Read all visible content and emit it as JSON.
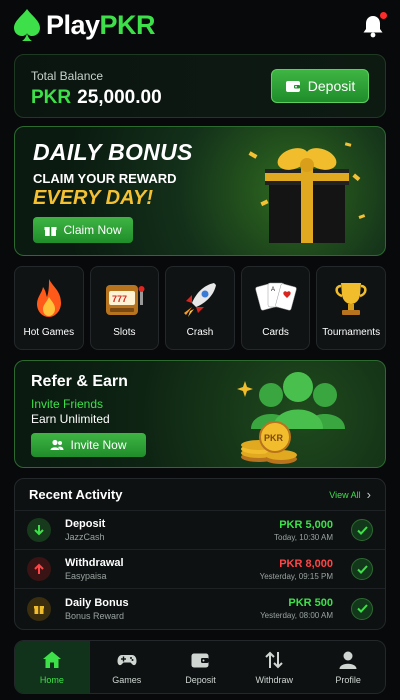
{
  "app": {
    "logo_play": "Play",
    "logo_pkr": "PKR"
  },
  "colors": {
    "accent": "#3ee04a",
    "gold": "#f5c132",
    "danger": "#ff4545",
    "notification_dot": "#ff2b2b"
  },
  "header": {
    "bell_icon": "bell-icon",
    "has_notification": true
  },
  "balance": {
    "label": "Total Balance",
    "currency": "PKR",
    "amount": "25,000.00",
    "deposit_label": "Deposit",
    "deposit_icon": "wallet-icon"
  },
  "daily_bonus": {
    "title": "DAILY BONUS",
    "subtitle": "CLAIM YOUR REWARD",
    "tagline": "EVERY DAY!",
    "button_label": "Claim Now",
    "button_icon": "gift-icon"
  },
  "categories": [
    {
      "label": "Hot Games",
      "icon": "fire-icon"
    },
    {
      "label": "Slots",
      "icon": "slot-machine-icon"
    },
    {
      "label": "Crash",
      "icon": "rocket-icon"
    },
    {
      "label": "Cards",
      "icon": "cards-icon"
    },
    {
      "label": "Tournaments",
      "icon": "trophy-icon"
    }
  ],
  "refer": {
    "title": "Refer & Earn",
    "line1": "Invite Friends",
    "line2": "Earn Unlimited",
    "button_label": "Invite Now",
    "button_icon": "users-icon",
    "coin_label": "PKR"
  },
  "activity": {
    "title": "Recent Activity",
    "view_all": "View All",
    "items": [
      {
        "name": "Deposit",
        "meta": "JazzCash",
        "amount": "PKR 5,000",
        "time": "Today, 10:30 AM",
        "icon": "arrow-down-icon",
        "amount_color": "#3ee04a"
      },
      {
        "name": "Withdrawal",
        "meta": "Easypaisa",
        "amount": "PKR 8,000",
        "time": "Yesterday, 09:15 PM",
        "icon": "arrow-up-icon",
        "amount_color": "#ff4545"
      },
      {
        "name": "Daily Bonus",
        "meta": "Bonus Reward",
        "amount": "PKR 500",
        "time": "Yesterday, 08:00 AM",
        "icon": "gift-icon",
        "amount_color": "#3ee04a"
      }
    ]
  },
  "nav": [
    {
      "label": "Home",
      "icon": "home-icon",
      "active": true
    },
    {
      "label": "Games",
      "icon": "gamepad-icon",
      "active": false
    },
    {
      "label": "Deposit",
      "icon": "wallet-icon",
      "active": false
    },
    {
      "label": "Withdraw",
      "icon": "transfer-icon",
      "active": false
    },
    {
      "label": "Profile",
      "icon": "user-icon",
      "active": false
    }
  ]
}
